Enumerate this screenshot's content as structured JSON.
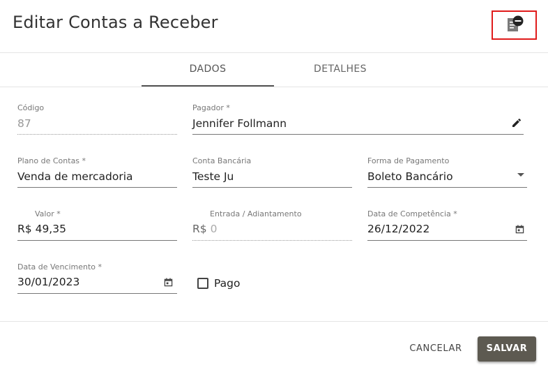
{
  "header": {
    "title": "Editar Contas a Receber",
    "action_icon": "receipt-minus-icon",
    "highlight_color": "#e01b1b"
  },
  "tabs": [
    {
      "label": "DADOS",
      "active": true
    },
    {
      "label": "DETALHES",
      "active": false
    }
  ],
  "form": {
    "codigo": {
      "label": "Código",
      "value": "87"
    },
    "pagador": {
      "label": "Pagador *",
      "value": "Jennifer Follmann",
      "icon": "pencil-icon"
    },
    "plano_contas": {
      "label": "Plano de Contas *",
      "value": "Venda de mercadoria"
    },
    "conta_bancaria": {
      "label": "Conta Bancária",
      "value": "Teste Ju"
    },
    "forma_pagamento": {
      "label": "Forma de Pagamento",
      "value": "Boleto Bancário",
      "icon": "dropdown-arrow-icon"
    },
    "valor": {
      "label": "Valor *",
      "prefix": "R$",
      "value": "49,35"
    },
    "entrada": {
      "label": "Entrada / Adiantamento",
      "prefix": "R$",
      "value": "0"
    },
    "data_competencia": {
      "label": "Data de Competência *",
      "value": "26/12/2022",
      "icon": "calendar-icon"
    },
    "data_vencimento": {
      "label": "Data de Vencimento *",
      "value": "30/01/2023",
      "icon": "calendar-icon"
    },
    "pago": {
      "label": "Pago",
      "checked": false
    }
  },
  "footer": {
    "cancel_label": "CANCELAR",
    "save_label": "SALVAR",
    "save_color": "#5d5a51"
  }
}
